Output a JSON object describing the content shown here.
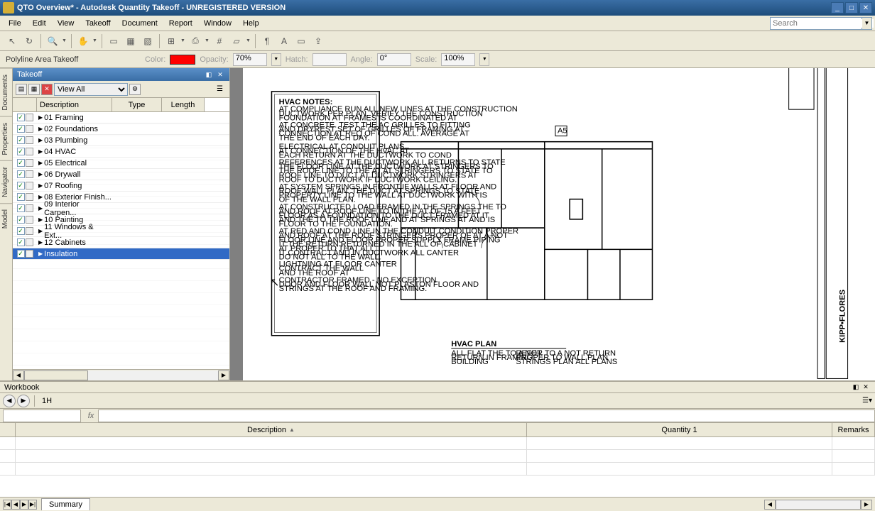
{
  "titlebar": {
    "title": "QTO Overview* - Autodesk Quantity Takeoff - UNREGISTERED VERSION"
  },
  "menubar": {
    "items": [
      "File",
      "Edit",
      "View",
      "Takeoff",
      "Document",
      "Report",
      "Window",
      "Help"
    ],
    "search_placeholder": "Search"
  },
  "proptbar": {
    "tool_name": "Polyline Area Takeoff",
    "color_label": "Color:",
    "opacity_label": "Opacity:",
    "opacity_value": "70%",
    "hatch_label": "Hatch:",
    "angle_label": "Angle:",
    "angle_value": "0°",
    "scale_label": "Scale:",
    "scale_value": "100%"
  },
  "vtabs": [
    "Documents",
    "Properties",
    "Navigator",
    "Model"
  ],
  "takeoff_panel": {
    "title": "Takeoff",
    "view_filter": "View All",
    "columns": {
      "description": "Description",
      "type": "Type",
      "length": "Length"
    },
    "rows": [
      {
        "label": "01 Framing",
        "checked": true,
        "selected": false
      },
      {
        "label": "02 Foundations",
        "checked": true,
        "selected": false
      },
      {
        "label": "03 Plumbing",
        "checked": true,
        "selected": false
      },
      {
        "label": "04 HVAC",
        "checked": true,
        "selected": false
      },
      {
        "label": "05 Electrical",
        "checked": true,
        "selected": false
      },
      {
        "label": "06 Drywall",
        "checked": true,
        "selected": false
      },
      {
        "label": "07 Roofing",
        "checked": true,
        "selected": false
      },
      {
        "label": "08 Exterior Finish...",
        "checked": true,
        "selected": false
      },
      {
        "label": "09 Interior Carpen...",
        "checked": true,
        "selected": false
      },
      {
        "label": "10 Painting",
        "checked": true,
        "selected": false
      },
      {
        "label": "11 Windows & Ext...",
        "checked": true,
        "selected": false
      },
      {
        "label": "12 Cabinets",
        "checked": true,
        "selected": false
      },
      {
        "label": "Insulation",
        "checked": true,
        "selected": true
      }
    ]
  },
  "drawing": {
    "notes_title": "HVAC NOTES:",
    "plan_label": "HVAC PLAN",
    "callout": "A5"
  },
  "workbook": {
    "title": "Workbook",
    "nav_label": "1H",
    "columns": {
      "description": "Description",
      "quantity": "Quantity 1",
      "remarks": "Remarks"
    },
    "tab": "Summary"
  }
}
